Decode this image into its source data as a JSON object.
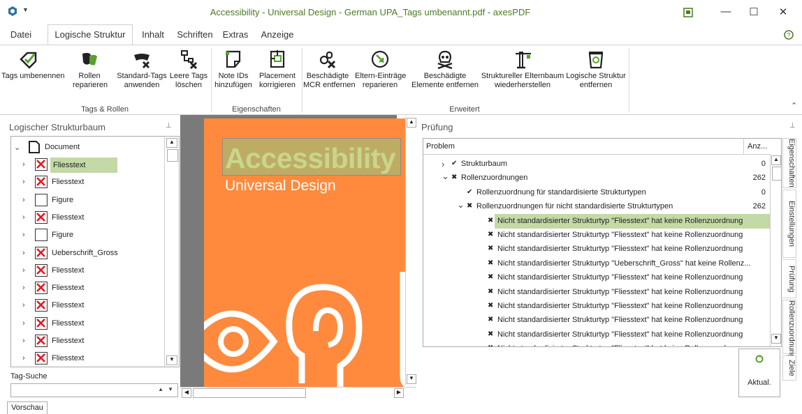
{
  "window": {
    "title": "Accessibility - Universal Design - German UPA_Tags umbenannt.pdf - axesPDF",
    "minimize": "—",
    "maximize": "☐",
    "close": "✕"
  },
  "menu": {
    "tabs": [
      "Datei",
      "Logische Struktur",
      "Inhalt",
      "Schriften",
      "Extras",
      "Anzeige"
    ],
    "active": "Logische Struktur"
  },
  "ribbon": {
    "groups": [
      {
        "label": "Tags & Rollen",
        "buttons": [
          "Tags umbenennen",
          "Rollen\nreparieren",
          "Standard-Tags\nanwenden",
          "Leere Tags\nlöschen"
        ]
      },
      {
        "label": "Eigenschaften",
        "buttons": [
          "Note IDs\nhinzufügen",
          "Placement\nkorrigieren"
        ]
      },
      {
        "label": "Erweitert",
        "buttons": [
          "Beschädigte\nMCR entfernen",
          "Eltern-Einträge\nreparieren",
          "Beschädigte\nElemente entfernen",
          "Struktureller Elternbaum\nwiederherstellen",
          "Logische Struktur\nentfernen"
        ]
      }
    ]
  },
  "tree": {
    "title": "Logischer Strukturbaum",
    "root": "Document",
    "items": [
      {
        "label": "Fliesstext",
        "icon": "red-x"
      },
      {
        "label": "Fliesstext",
        "icon": "red-x"
      },
      {
        "label": "Figure",
        "icon": "box"
      },
      {
        "label": "Fliesstext",
        "icon": "red-x"
      },
      {
        "label": "Figure",
        "icon": "box"
      },
      {
        "label": "Ueberschrift_Gross",
        "icon": "red-x"
      },
      {
        "label": "Fliesstext",
        "icon": "red-x"
      },
      {
        "label": "Fliesstext",
        "icon": "red-x"
      },
      {
        "label": "Fliesstext",
        "icon": "red-x"
      },
      {
        "label": "Fliesstext",
        "icon": "red-x"
      },
      {
        "label": "Fliesstext",
        "icon": "red-x"
      },
      {
        "label": "Fliesstext",
        "icon": "red-x"
      }
    ],
    "search_label": "Tag-Suche",
    "search_value": ""
  },
  "preview": {
    "title": "Accessibility",
    "subtitle": "Universal Design",
    "bg_color": "#ff8a3d",
    "tab": "Vorschau"
  },
  "check": {
    "title": "Prüfung",
    "col_problem": "Problem",
    "col_count": "Anz...",
    "rows": [
      {
        "text": "Strukturbaum",
        "count": "0",
        "mark": "✔",
        "chev": "›",
        "level": 1
      },
      {
        "text": "Rollenzuordnungen",
        "count": "262",
        "mark": "✖",
        "chev": "⌄",
        "level": 1
      },
      {
        "text": "Rollenzuordnung für standardisierte Strukturtypen",
        "count": "0",
        "mark": "✔",
        "chev": "",
        "level": 2
      },
      {
        "text": "Rollenzuordnungen für nicht standardisierte Strukturtypen",
        "count": "262",
        "mark": "✖",
        "chev": "⌄",
        "level": 2
      },
      {
        "text": "Nicht standardisierter Strukturtyp \"Fliesstext\" hat keine Rollenzuordnung",
        "count": "",
        "mark": "✖",
        "chev": "",
        "level": 3
      },
      {
        "text": "Nicht standardisierter Strukturtyp \"Fliesstext\" hat keine Rollenzuordnung",
        "count": "",
        "mark": "✖",
        "chev": "",
        "level": 3
      },
      {
        "text": "Nicht standardisierter Strukturtyp \"Fliesstext\" hat keine Rollenzuordnung",
        "count": "",
        "mark": "✖",
        "chev": "",
        "level": 3
      },
      {
        "text": "Nicht standardisierter Strukturtyp \"Ueberschrift_Gross\" hat keine Rollenz...",
        "count": "",
        "mark": "✖",
        "chev": "",
        "level": 3
      },
      {
        "text": "Nicht standardisierter Strukturtyp \"Fliesstext\" hat keine Rollenzuordnung",
        "count": "",
        "mark": "✖",
        "chev": "",
        "level": 3
      },
      {
        "text": "Nicht standardisierter Strukturtyp \"Fliesstext\" hat keine Rollenzuordnung",
        "count": "",
        "mark": "✖",
        "chev": "",
        "level": 3
      },
      {
        "text": "Nicht standardisierter Strukturtyp \"Fliesstext\" hat keine Rollenzuordnung",
        "count": "",
        "mark": "✖",
        "chev": "",
        "level": 3
      },
      {
        "text": "Nicht standardisierter Strukturtyp \"Fliesstext\" hat keine Rollenzuordnung",
        "count": "",
        "mark": "✖",
        "chev": "",
        "level": 3
      },
      {
        "text": "Nicht standardisierter Strukturtyp \"Fliesstext\" hat keine Rollenzuordnung",
        "count": "",
        "mark": "✖",
        "chev": "",
        "level": 3
      },
      {
        "text": "Nicht standardisierter Strukturtyp \"Fliesstext\" hat keine Rollenzuordnung",
        "count": "",
        "mark": "✖",
        "chev": "",
        "level": 3
      }
    ],
    "refresh_label": "Aktual."
  },
  "side_tabs": [
    "Eigenschaften",
    "Einstellungen",
    "Prüfung",
    "Rollenzuordnungen",
    "Ziele"
  ]
}
